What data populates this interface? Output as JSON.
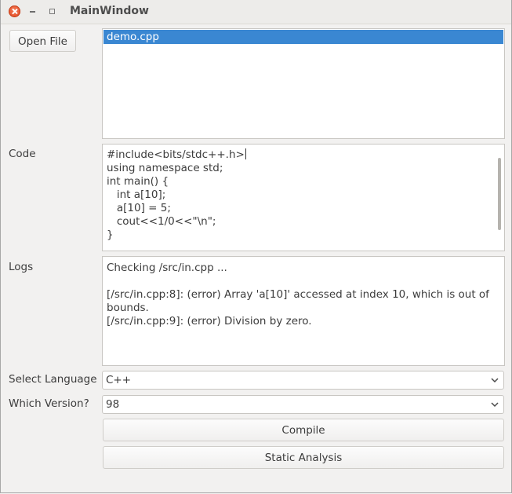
{
  "window": {
    "title": "MainWindow"
  },
  "toolbar": {
    "open_file_label": "Open File"
  },
  "file_list": {
    "items": [
      "demo.cpp"
    ]
  },
  "code": {
    "label": "Code",
    "lines": [
      "#include<bits/stdc++.h>",
      "using namespace std;",
      "int main() {",
      "   int a[10];",
      "   a[10] = 5;",
      "   cout<<1/0<<\"\\n\";",
      "}"
    ]
  },
  "logs": {
    "label": "Logs",
    "lines": [
      "Checking /src/in.cpp ...",
      "",
      "[/src/in.cpp:8]: (error) Array 'a[10]' accessed at index 10, which is out of bounds.",
      "[/src/in.cpp:9]: (error) Division by zero."
    ]
  },
  "language": {
    "label": "Select Language",
    "selected": "C++"
  },
  "version": {
    "label": "Which Version?",
    "selected": "98"
  },
  "actions": {
    "compile_label": "Compile",
    "static_analysis_label": "Static Analysis"
  },
  "colors": {
    "selection": "#3a87d2",
    "close_button": "#e0461d"
  },
  "icons": {
    "close": "close-icon",
    "minimize": "minimize-icon",
    "maximize": "maximize-icon",
    "dropdown": "chevron-down-icon"
  }
}
